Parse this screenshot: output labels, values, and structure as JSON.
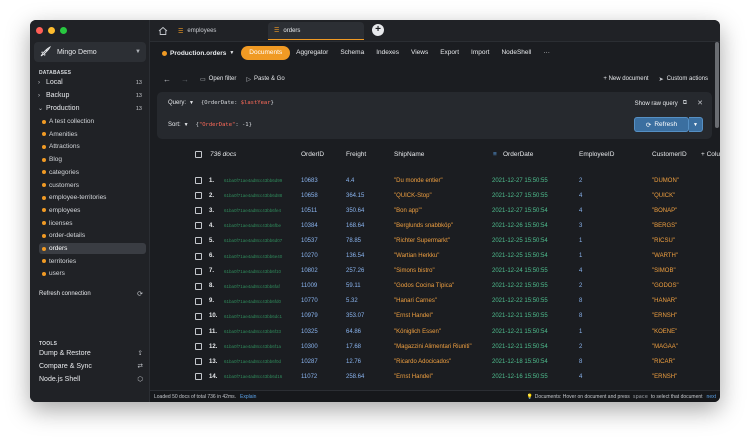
{
  "app": {
    "connection_name": "Mingo Demo",
    "databases_label": "DATABASES",
    "tools_label": "TOOLS",
    "refresh_connection": "Refresh connection"
  },
  "databases": [
    {
      "name": "Local",
      "count": "13",
      "expanded": false
    },
    {
      "name": "Backup",
      "count": "13",
      "expanded": false
    },
    {
      "name": "Production",
      "count": "13",
      "expanded": true
    }
  ],
  "collections": [
    "A test collection",
    "Amenities",
    "Attractions",
    "Blog",
    "categories",
    "customers",
    "employee-territories",
    "employees",
    "licenses",
    "order-details",
    "orders",
    "territories",
    "users"
  ],
  "active_collection": "orders",
  "tools": [
    {
      "label": "Dump & Restore",
      "icon": "upload-icon"
    },
    {
      "label": "Compare & Sync",
      "icon": "sync-icon"
    },
    {
      "label": "Node.js Shell",
      "icon": "nodejs-icon"
    }
  ],
  "tabs": [
    {
      "label": "employees",
      "active": false
    },
    {
      "label": "orders",
      "active": true
    }
  ],
  "nav": {
    "db_selector": "Production.orders",
    "items": [
      "Documents",
      "Aggregator",
      "Schema",
      "Indexes",
      "Views",
      "Export",
      "Import",
      "NodeShell",
      "···"
    ],
    "active": "Documents"
  },
  "toolbar": {
    "open_filter": "Open filter",
    "paste_go": "Paste & Go",
    "new_document": "+ New document",
    "custom_actions": "Custom actions"
  },
  "query": {
    "query_label": "Query:",
    "query_open": "{OrderDate: ",
    "query_value": "$lastYear",
    "query_close": "}",
    "sort_label": "Sort:",
    "sort_open": "{",
    "sort_field": "\"OrderDate\"",
    "sort_value": ": -1}",
    "show_raw": "Show raw query",
    "refresh": "Refresh"
  },
  "table": {
    "count_label": "736 docs",
    "columns": [
      "OrderID",
      "Freight",
      "ShipName",
      "OrderDate",
      "EmployeeID",
      "CustomerID",
      "+ Colu"
    ],
    "rows": [
      {
        "idx": "1.",
        "id": "61ba0f71ae4ad8cc43bb6d99",
        "order": "10683",
        "freight": "4.4",
        "ship": "\"Du monde entier\"",
        "date": "2021-12-27 15:50:55",
        "emp": "2",
        "cust": "\"DUMON\""
      },
      {
        "idx": "2.",
        "id": "61ba0f71ae4ad8cc43bb6d88",
        "order": "10658",
        "freight": "364.15",
        "ship": "\"QUICK-Stop\"",
        "date": "2021-12-27 15:50:55",
        "emp": "4",
        "cust": "\"QUICK\""
      },
      {
        "idx": "3.",
        "id": "61ba0f71ae4ad8cc43bb6fe4",
        "order": "10511",
        "freight": "350.64",
        "ship": "\"Bon app'\"",
        "date": "2021-12-27 15:50:54",
        "emp": "4",
        "cust": "\"BONAP\""
      },
      {
        "idx": "4.",
        "id": "61ba0f71ae4ad8cc43bb6fbe",
        "order": "10384",
        "freight": "168.64",
        "ship": "\"Berglunds snabbköp\"",
        "date": "2021-12-26 15:50:54",
        "emp": "3",
        "cust": "\"BERGS\""
      },
      {
        "idx": "5.",
        "id": "61ba0f71ae4ad8cc43bb6d07",
        "order": "10537",
        "freight": "78.85",
        "ship": "\"Richter Supermarkt\"",
        "date": "2021-12-25 15:50:54",
        "emp": "1",
        "cust": "\"RICSU\""
      },
      {
        "idx": "6.",
        "id": "61ba0f71ae4ad8cc43bb6e40",
        "order": "10270",
        "freight": "136.54",
        "ship": "\"Wartian Herkku\"",
        "date": "2021-12-25 15:50:54",
        "emp": "1",
        "cust": "\"WARTH\""
      },
      {
        "idx": "7.",
        "id": "61ba0f71ae4ad8cc43bb6f10",
        "order": "10802",
        "freight": "257.26",
        "ship": "\"Simons bistro\"",
        "date": "2021-12-24 15:50:55",
        "emp": "4",
        "cust": "\"SIMOB\""
      },
      {
        "idx": "8.",
        "id": "61ba0f71ae4ad8cc43bb6faf",
        "order": "11009",
        "freight": "59.11",
        "ship": "\"Godos Cocina Típica\"",
        "date": "2021-12-22 15:50:55",
        "emp": "2",
        "cust": "\"GODOS\""
      },
      {
        "idx": "9.",
        "id": "61ba0f71ae4ad8cc43bb6fd0",
        "order": "10770",
        "freight": "5.32",
        "ship": "\"Hanari Carnes\"",
        "date": "2021-12-22 15:50:55",
        "emp": "8",
        "cust": "\"HANAR\""
      },
      {
        "idx": "10.",
        "id": "61ba0f71ae4ad8cc43bb6dc1",
        "order": "10979",
        "freight": "353.07",
        "ship": "\"Ernst Handel\"",
        "date": "2021-12-21 15:50:55",
        "emp": "8",
        "cust": "\"ERNSH\""
      },
      {
        "idx": "11.",
        "id": "61ba0f71ae4ad8cc43bb6f33",
        "order": "10325",
        "freight": "64.86",
        "ship": "\"Königlich Essen\"",
        "date": "2021-12-21 15:50:54",
        "emp": "1",
        "cust": "\"KOENE\""
      },
      {
        "idx": "12.",
        "id": "61ba0f71ae4ad8cc43bb6f1a",
        "order": "10300",
        "freight": "17.68",
        "ship": "\"Magazzini Alimentari Riuniti\"",
        "date": "2021-12-21 15:50:54",
        "emp": "2",
        "cust": "\"MAGAA\""
      },
      {
        "idx": "13.",
        "id": "61ba0f71ae4ad8cc43bb6f0d",
        "order": "10287",
        "freight": "12.76",
        "ship": "\"Ricardo Adocicados\"",
        "date": "2021-12-18 15:50:54",
        "emp": "8",
        "cust": "\"RICAR\""
      },
      {
        "idx": "14.",
        "id": "61ba0f71ae4ad8cc43bb6d16",
        "order": "11072",
        "freight": "258.64",
        "ship": "\"Ernst Handel\"",
        "date": "2021-12-16 15:50:55",
        "emp": "4",
        "cust": "\"ERNSH\""
      }
    ]
  },
  "status": {
    "loaded": "Loaded 50 docs of total 736 in 42ms.",
    "explain": "Explain",
    "hint_pre": "Documents: Hover on document and press",
    "hint_key": "space",
    "hint_post": "to select that document",
    "next": "next"
  },
  "colors": {
    "accent": "#f09a24",
    "button_blue": "#3b6fa0",
    "number": "#8ab4ef",
    "string": "#f0a040",
    "date": "#4fbf8f"
  }
}
